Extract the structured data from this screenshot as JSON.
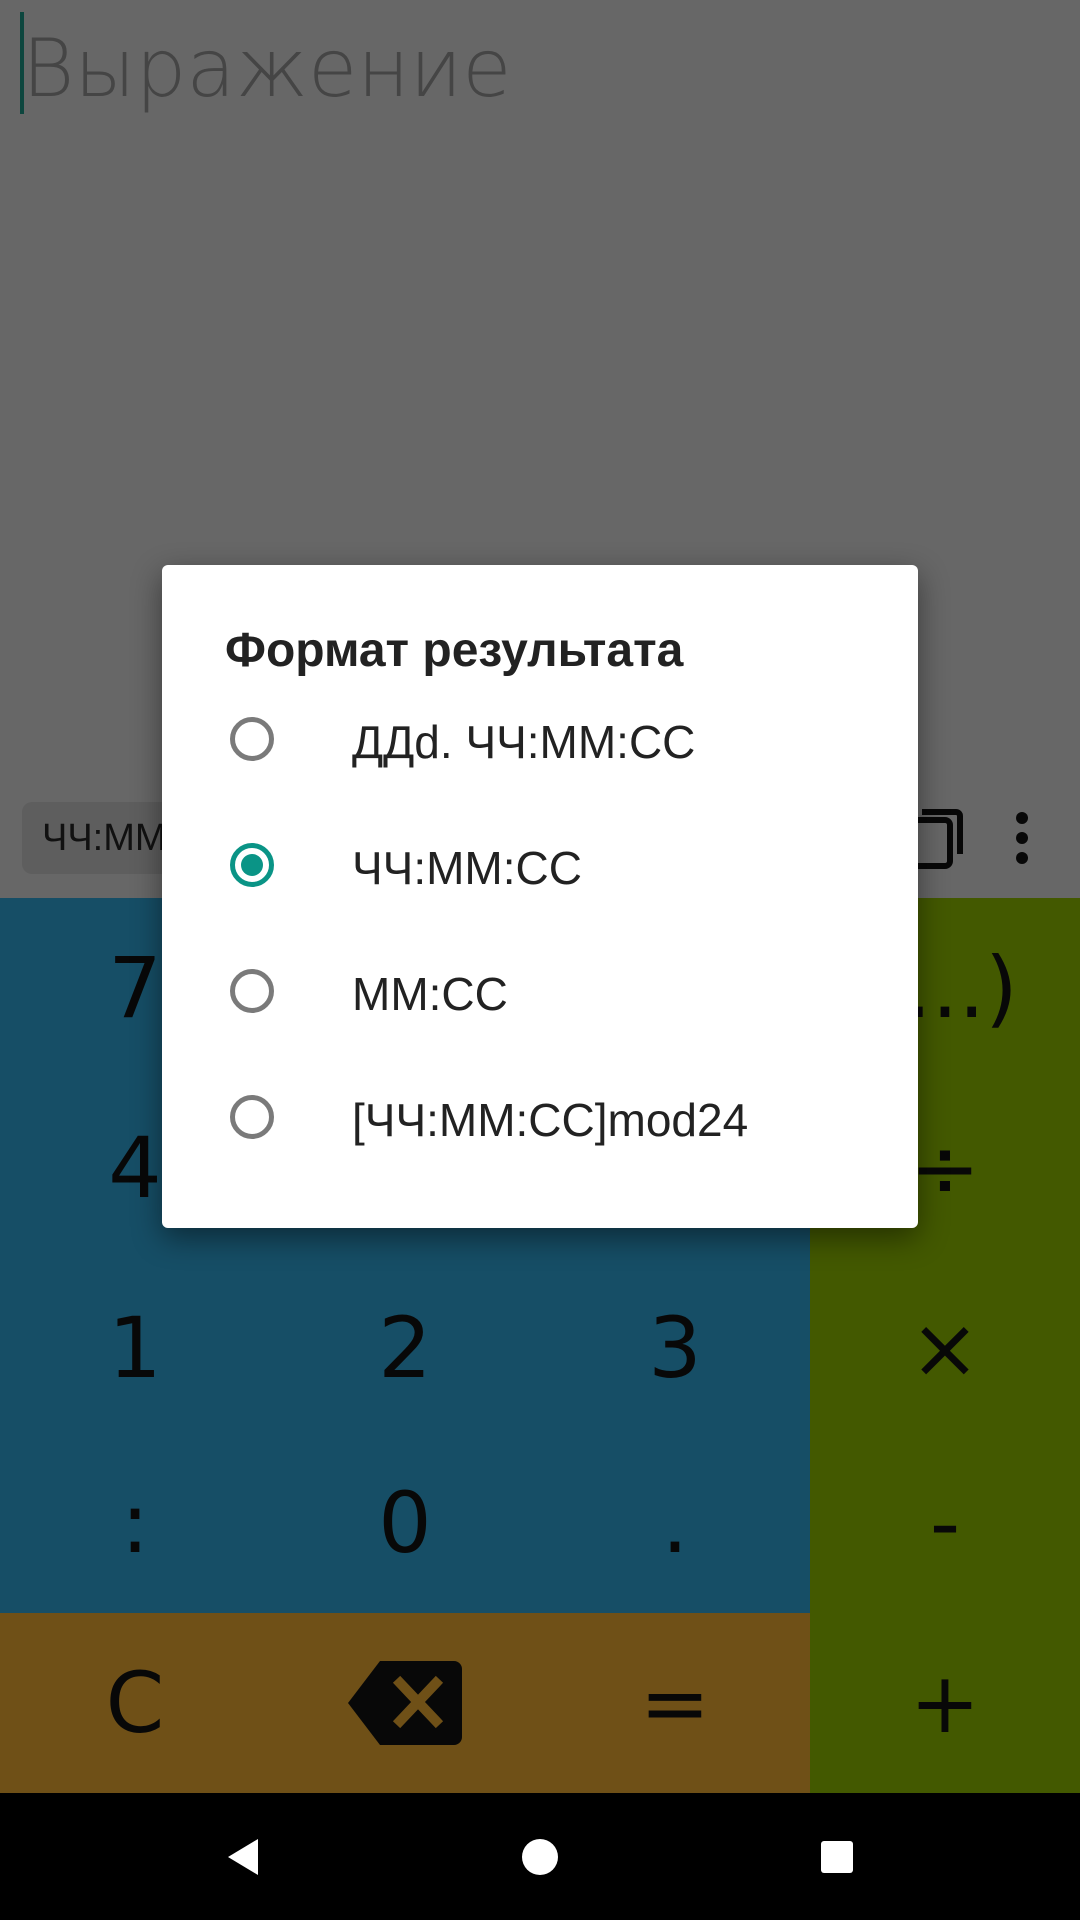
{
  "expression": {
    "placeholder": "Выражение",
    "value": ""
  },
  "toolbar": {
    "format_chip": "ЧЧ:ММ",
    "copy_icon": "copy-icon",
    "menu_icon": "more-vert-icon"
  },
  "keypad": {
    "rows": [
      [
        "7",
        "",
        "",
        "(...)"
      ],
      [
        "4",
        "",
        "",
        "÷"
      ],
      [
        "1",
        "2",
        "3",
        "×"
      ],
      [
        ":",
        "0",
        ".",
        "-"
      ],
      [
        "C",
        "backspace-icon",
        "=",
        "+"
      ]
    ]
  },
  "colors": {
    "numbers_bg": "#2d9ccc",
    "operators_bg": "#86b300",
    "controls_bg": "#dfa12f",
    "accent": "#0a9486"
  },
  "dialog": {
    "title": "Формат результата",
    "options": [
      {
        "label": "ДДd. ЧЧ:ММ:СС",
        "checked": false
      },
      {
        "label": "ЧЧ:ММ:СС",
        "checked": true
      },
      {
        "label": "ММ:СС",
        "checked": false
      },
      {
        "label": "[ЧЧ:ММ:СС]mod24",
        "checked": false
      }
    ]
  },
  "navbar": {
    "back": "back-icon",
    "home": "home-icon",
    "recents": "recents-icon"
  }
}
